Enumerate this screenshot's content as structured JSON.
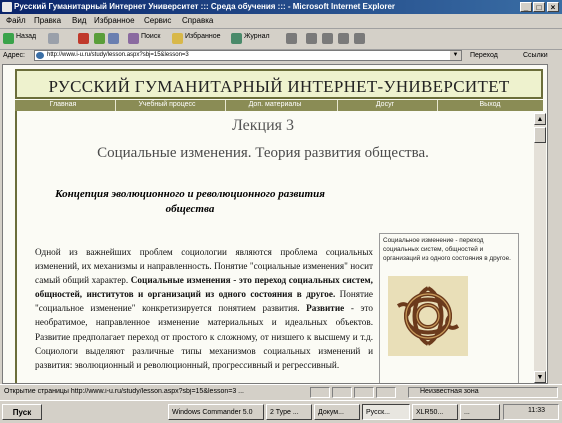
{
  "window": {
    "title": "Русский Гуманитарный Интернет Университет ::: Среда обучения ::: - Microsoft Internet Explorer",
    "controls": [
      "_",
      "□",
      "×"
    ]
  },
  "menu": [
    "Файл",
    "Правка",
    "Вид",
    "Избранное",
    "Сервис",
    "Справка"
  ],
  "toolbar": {
    "back": "Назад",
    "search": "Поиск",
    "favorites": "Избранное",
    "journal": "Журнал"
  },
  "address": {
    "label": "Адрес:",
    "url": "http://www.i-u.ru/study/lesson.aspx?sbj=15&lesson=3",
    "go": "Переход",
    "links": "Ссылки"
  },
  "page": {
    "banner": "РУССКИЙ ГУМАНИТАРНЫЙ ИНТЕРНЕТ-УНИВЕРСИТЕТ",
    "nav": [
      "Главная",
      "Учебный процесс",
      "Доп. материалы",
      "Досуг",
      "Выход"
    ],
    "lecture": "Лекция 3",
    "topic": "Социальные изменения. Теория развития общества.",
    "section_heading": "Концепция эволюционного и революционного развития общества",
    "paragraph": [
      {
        "text": "Одной из важнейших проблем социологии являются проблема социальных изменений, их механизмы и направленность. Понятие \"социальные изменения\" носит самый общий характер. ",
        "bold": false
      },
      {
        "text": "Социальные изменения - это переход социальных систем, общностей, институтов и организаций из одного состояния в другое.",
        "bold": true
      },
      {
        "text": " Понятие \"социальное изменение\" конкретизируется понятием развития. ",
        "bold": false
      },
      {
        "text": "Развитие",
        "bold": true
      },
      {
        "text": " - это необратимое, направленное изменение материальных и идеальных объектов. Развитие предполагает переход от простого к сложному, от низшего к высшему и т.д. Социологи выделяют различные типы механизмов социальных изменений и развития: эволюционный и революционный, прогрессивный и регрессивный.",
        "bold": false
      }
    ],
    "side_note": "Социальное изменение - переход социальных систем, общностей и организаций из одного состояния в другое."
  },
  "status": {
    "text": "Открытие страницы http://www.i-u.ru/study/lesson.aspx?sbj=15&lesson=3 ...",
    "zone": "Неизвестная зона"
  },
  "taskbar": {
    "start": "Пуск",
    "tasks": [
      "Windows Commander 5.0",
      "2 Type ...",
      "Докум...",
      "Русск...",
      "XLR50...",
      "..."
    ],
    "clock": "11:33"
  },
  "colors": {
    "banner_bg": "#eef2ce",
    "banner_border": "#6b6e3a",
    "nav_bg": "#8a8c55"
  }
}
